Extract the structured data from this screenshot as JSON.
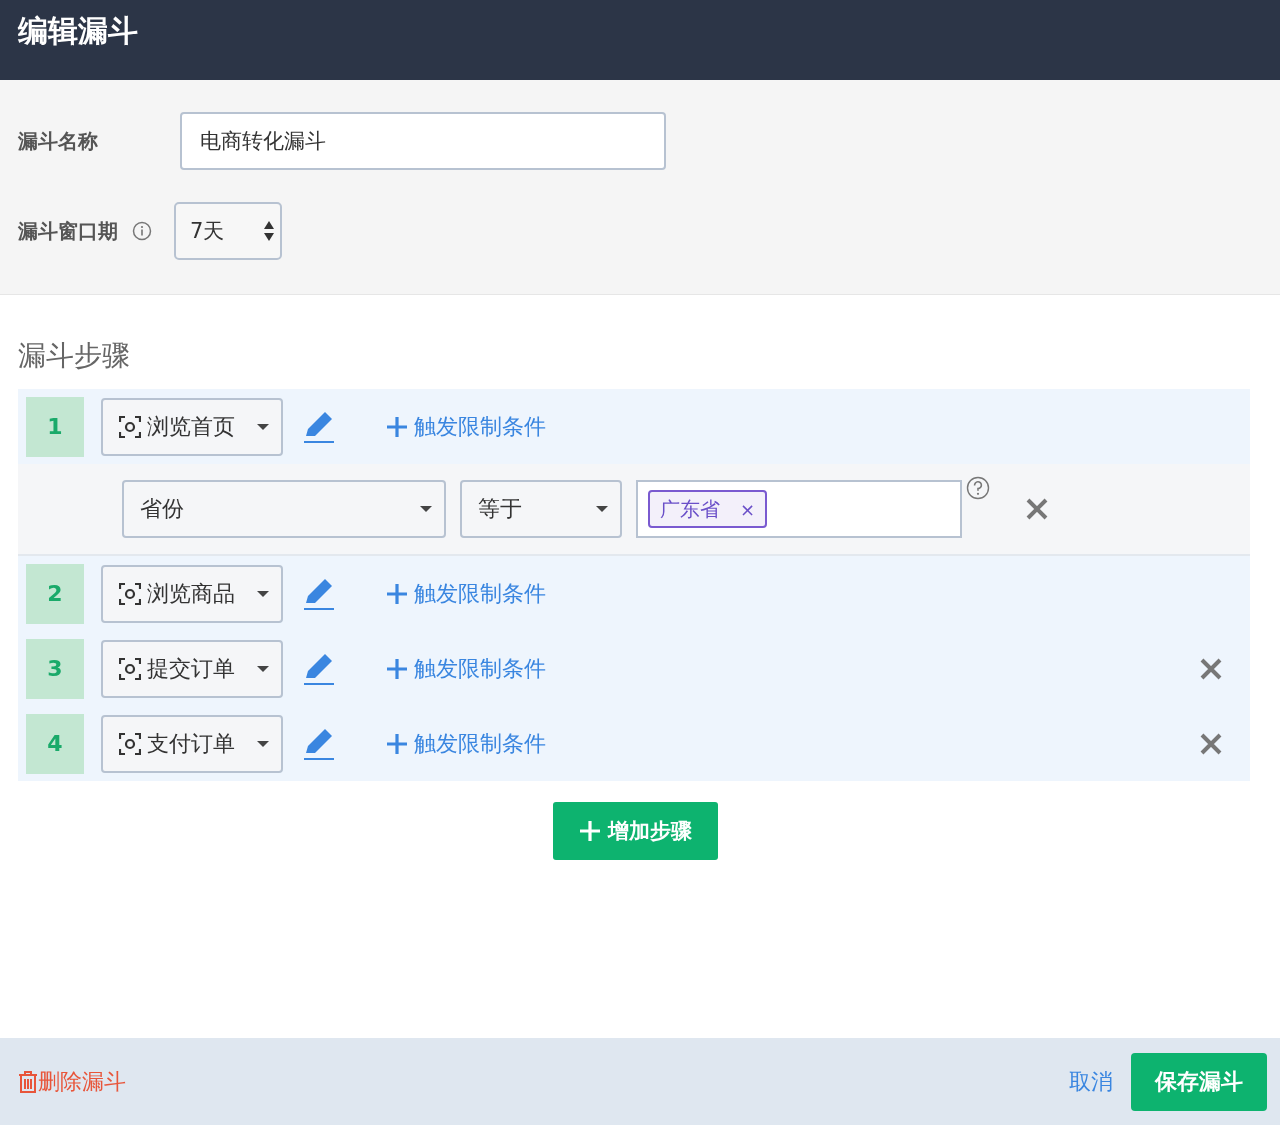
{
  "header": {
    "title": "编辑漏斗"
  },
  "form": {
    "name_label": "漏斗名称",
    "name_value": "电商转化漏斗",
    "window_label": "漏斗窗口期",
    "window_value": "7天"
  },
  "steps_title": "漏斗步骤",
  "steps": [
    {
      "number": "1",
      "event": "浏览首页",
      "add_condition": "触发限制条件",
      "removable": false,
      "conditions": [
        {
          "property": "省份",
          "operator": "等于",
          "tags": [
            "广东省"
          ],
          "tag_remove": "×"
        }
      ]
    },
    {
      "number": "2",
      "event": "浏览商品",
      "add_condition": "触发限制条件",
      "removable": false
    },
    {
      "number": "3",
      "event": "提交订单",
      "add_condition": "触发限制条件",
      "removable": true
    },
    {
      "number": "4",
      "event": "支付订单",
      "add_condition": "触发限制条件",
      "removable": true
    }
  ],
  "add_step": "增加步骤",
  "footer": {
    "delete": "删除漏斗",
    "cancel": "取消",
    "save": "保存漏斗"
  }
}
